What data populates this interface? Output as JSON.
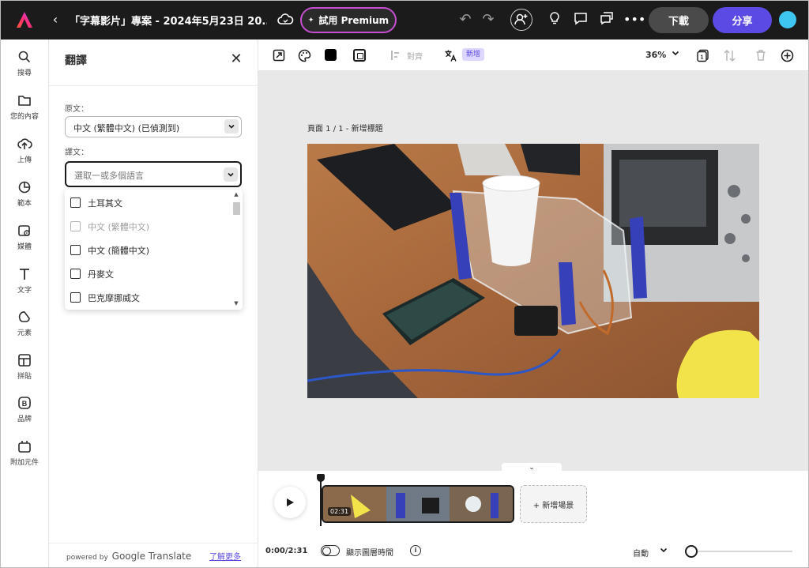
{
  "colors": {
    "topbar_bg": "#1b1b1b",
    "accent": "#5b4be4",
    "premium_border": "#c54fd0",
    "canvas_bg": "#e8e8e8",
    "avatar": "#3ec6f0"
  },
  "header": {
    "title": "「字幕影片」專案 - 2024年5月23日 20...",
    "premium_label": "試用 Premium",
    "download_label": "下載",
    "share_label": "分享"
  },
  "sidebar": {
    "items": [
      {
        "label": "搜尋",
        "icon": "search-icon"
      },
      {
        "label": "您的內容",
        "icon": "folder-icon"
      },
      {
        "label": "上傳",
        "icon": "upload-icon"
      },
      {
        "label": "範本",
        "icon": "templates-icon"
      },
      {
        "label": "媒體",
        "icon": "media-icon"
      },
      {
        "label": "文字",
        "icon": "text-icon"
      },
      {
        "label": "元素",
        "icon": "elements-icon"
      },
      {
        "label": "拼貼",
        "icon": "grid-icon"
      },
      {
        "label": "品牌",
        "icon": "brand-icon"
      },
      {
        "label": "附加元件",
        "icon": "addons-icon"
      }
    ]
  },
  "panel": {
    "title": "翻譯",
    "source_label": "原文：",
    "source_value": "中文 (繁體中文) (已偵測到)",
    "target_label": "譯文：",
    "target_placeholder": "選取一或多個語言",
    "options": [
      {
        "label": "土耳其文",
        "disabled": false
      },
      {
        "label": "中文 (繁體中文)",
        "disabled": true
      },
      {
        "label": "中文 (簡體中文)",
        "disabled": false
      },
      {
        "label": "丹麥文",
        "disabled": false
      },
      {
        "label": "巴克摩挪威文",
        "disabled": false
      }
    ],
    "powered_by": "powered by",
    "google_translate": "Google Translate",
    "learn_more": "了解更多"
  },
  "toolbar": {
    "align_label": "對齊",
    "new_badge": "新增",
    "zoom": "36%",
    "page_count": "1"
  },
  "canvas": {
    "page_label": "頁面 1 / 1 - 新增標題"
  },
  "timeline": {
    "clip_duration": "02:31",
    "add_scene": "+ 新增場景",
    "time": "0:00/2:31",
    "toggle_label": "顯示圖層時間",
    "auto_label": "自動"
  }
}
